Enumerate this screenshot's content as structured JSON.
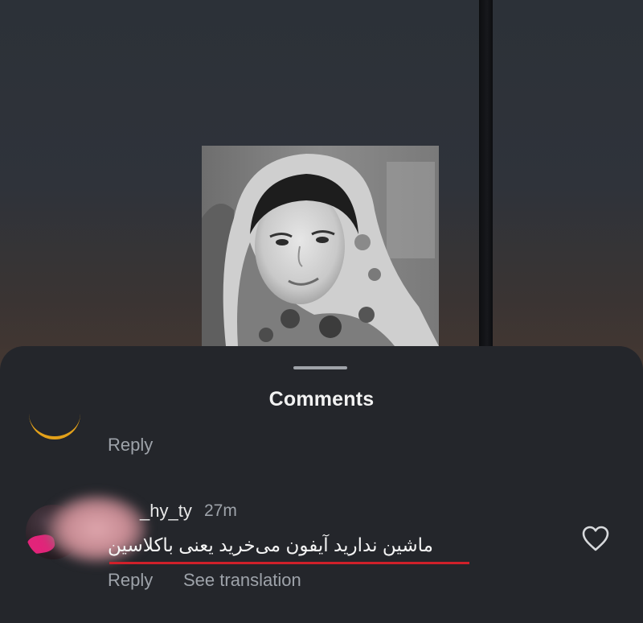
{
  "sheet": {
    "title": "Comments"
  },
  "previous_comment": {
    "reply_label": "Reply"
  },
  "comment": {
    "username": "_hy_ty",
    "timestamp": "27m",
    "text": "ماشین ندارید آیفون می‌خرید یعنی باکلاسین",
    "reply_label": "Reply",
    "translate_label": "See translation",
    "like_icon": "heart-outline-icon"
  },
  "colors": {
    "sheet_background": "#24262b",
    "highlight_underline": "#d0202a",
    "secondary_text": "#9ea3aa"
  }
}
